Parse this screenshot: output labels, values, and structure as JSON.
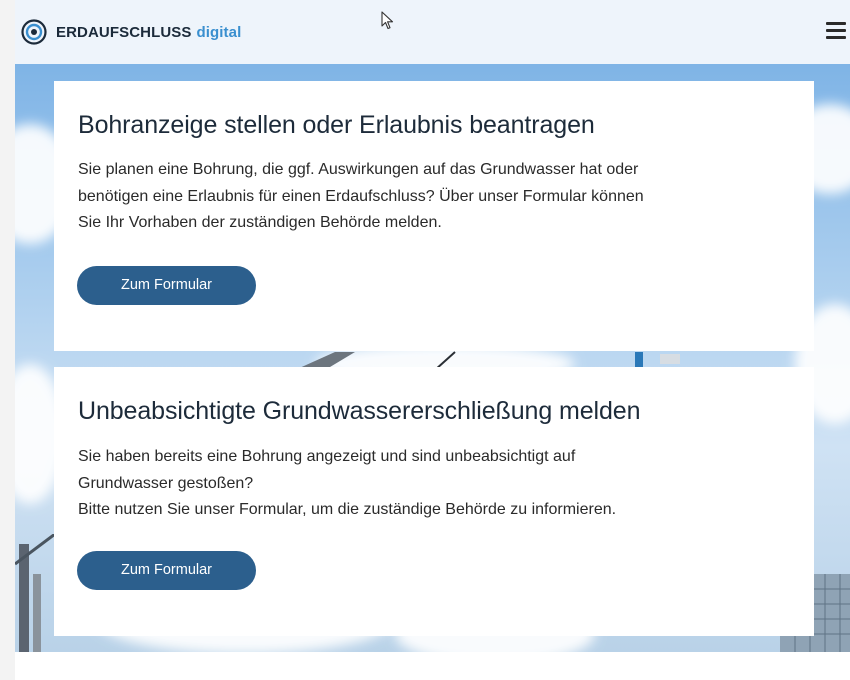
{
  "header": {
    "logo_main": "ERDAUFSCHLUSS",
    "logo_accent": "digital",
    "menu_icon": "hamburger-menu-icon"
  },
  "cards": [
    {
      "title": "Bohranzeige stellen oder Erlaubnis beantragen",
      "lines": [
        "Sie planen eine Bohrung, die ggf. Auswirkungen auf das Grundwasser hat oder",
        "benötigen eine Erlaubnis für einen Erdaufschluss? Über unser Formular können",
        "Sie Ihr Vorhaben der zuständigen Behörde melden."
      ],
      "button": "Zum Formular"
    },
    {
      "title": "Unbeabsichtigte Grundwassererschließung melden",
      "lines": [
        "Sie haben bereits eine Bohrung angezeigt und sind unbeabsichtigt auf",
        "Grundwasser gestoßen?",
        "Bitte nutzen Sie unser Formular, um die zuständige Behörde zu informieren."
      ],
      "button": "Zum Formular"
    }
  ],
  "colors": {
    "accent": "#3a8fcf",
    "button": "#2c5f8d",
    "topbar": "#eef4fb"
  }
}
